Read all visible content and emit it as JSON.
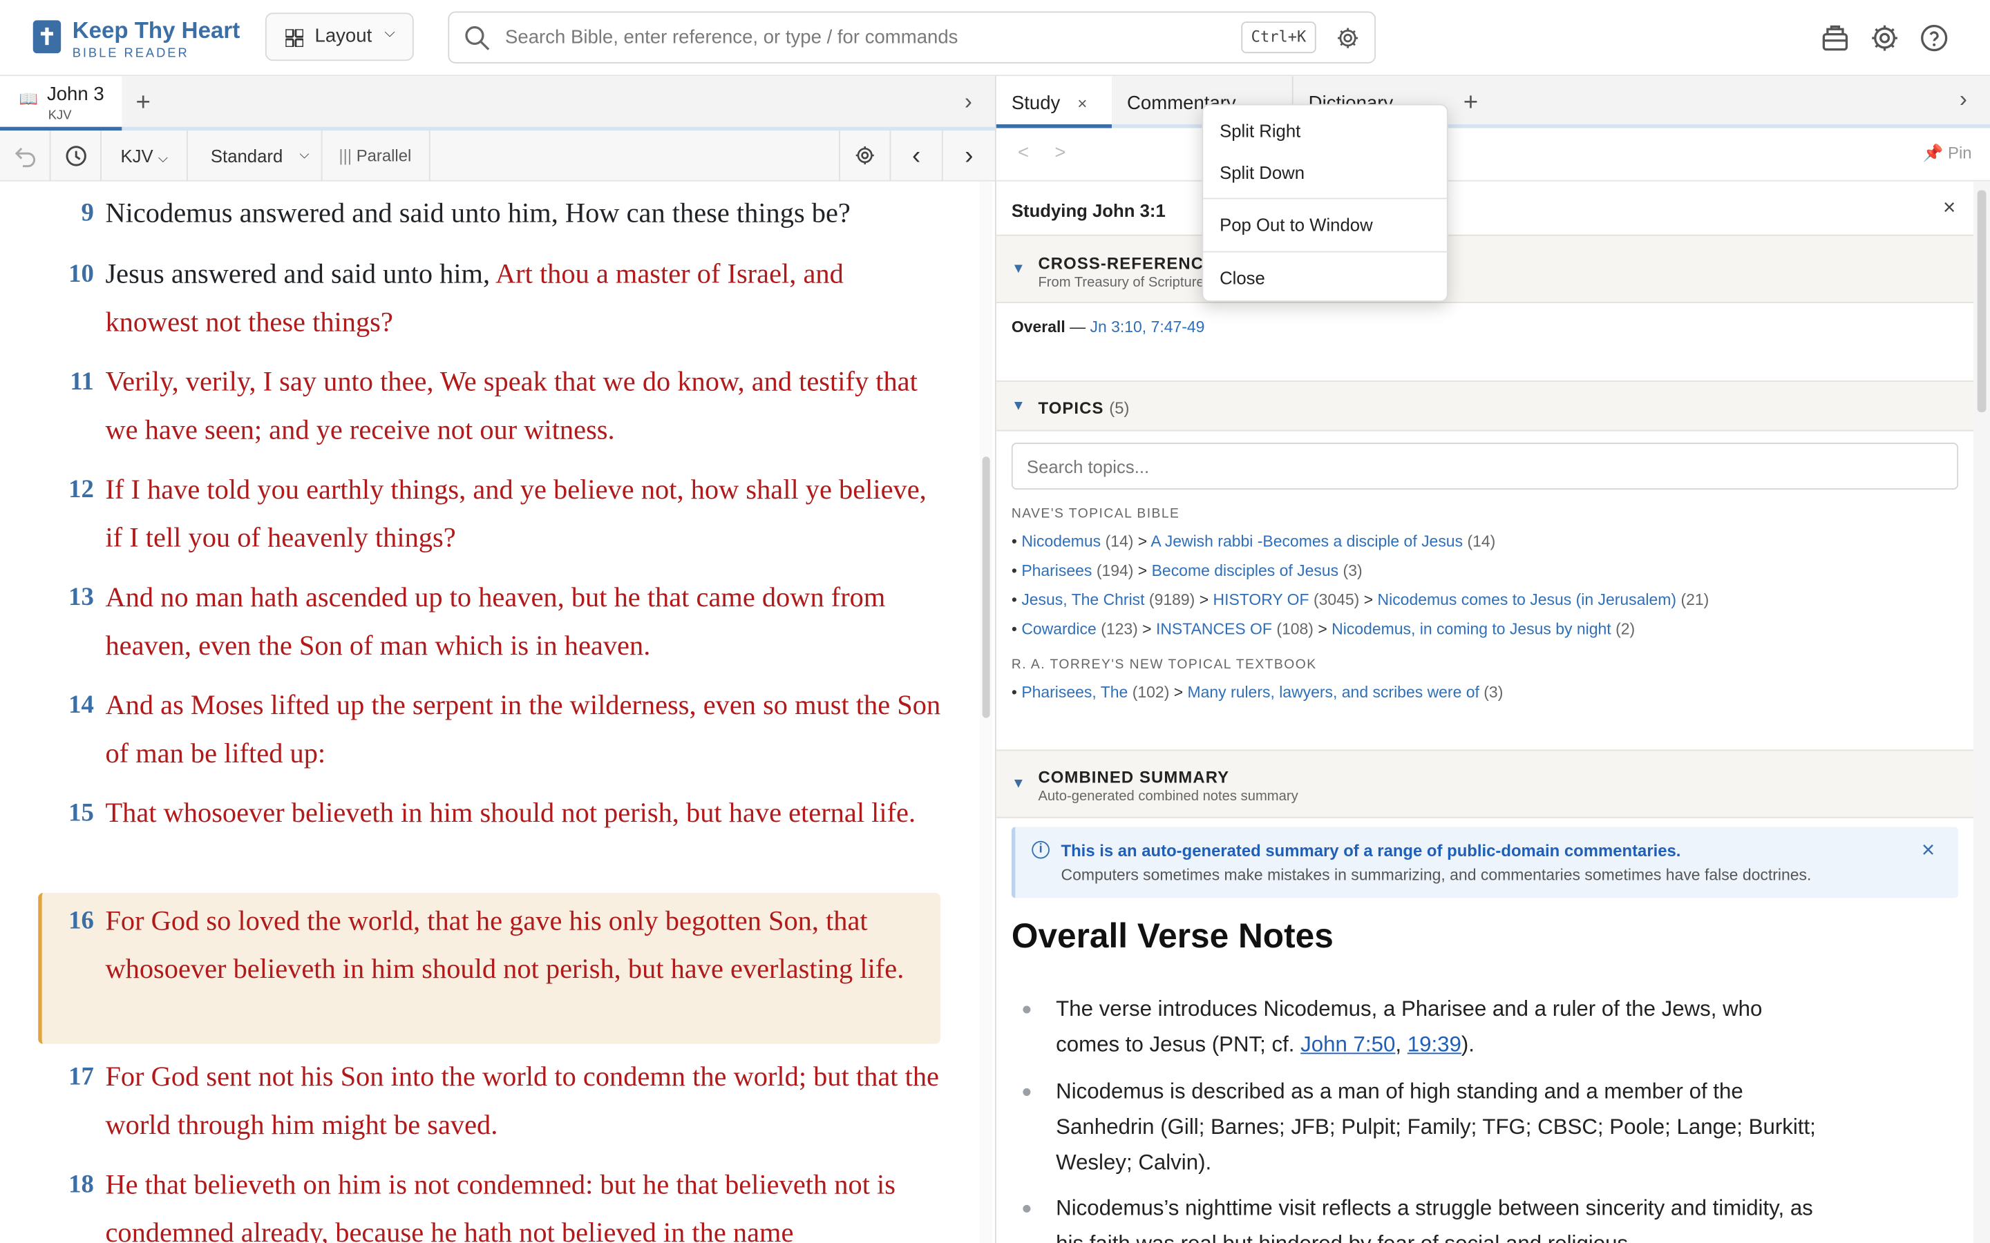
{
  "app": {
    "name": "Keep Thy Heart",
    "subtitle": "BIBLE READER"
  },
  "header": {
    "layout_label": "Layout",
    "search_placeholder": "Search Bible, enter reference, or type / for commands",
    "search_shortcut": "Ctrl+K"
  },
  "left": {
    "tab": {
      "title": "John 3",
      "version": "KJV"
    },
    "toolbar": {
      "version": "KJV",
      "mode": "Standard",
      "parallel": "Parallel"
    },
    "verses": [
      {
        "num": "9",
        "black": "Nicodemus answered and said unto him, How can these things be?",
        "red": ""
      },
      {
        "num": "10",
        "black": "Jesus answered and said unto him,",
        "red": "Art thou a master of Israel, and knowest not these things?"
      },
      {
        "num": "11",
        "black": "",
        "red": "Verily, verily, I say unto thee, We speak that we do know, and testify that we have seen; and ye receive not our witness."
      },
      {
        "num": "12",
        "black": "",
        "red": "If I have told you earthly things, and ye believe not, how shall ye believe, if I tell you of heavenly things?"
      },
      {
        "num": "13",
        "black": "",
        "red": "And no man hath ascended up to heaven, but he that came down from heaven, even the Son of man which is in heaven."
      },
      {
        "num": "14",
        "black": "",
        "red": "And as Moses lifted up the serpent in the wilderness, even so must the Son of man be lifted up:"
      },
      {
        "num": "15",
        "black": "",
        "red": "That whosoever believeth in him should not perish, but have eternal life."
      },
      {
        "num": "16",
        "black": "",
        "red": "For God so loved the world, that he gave his only begotten Son, that whosoever believeth in him should not perish, but have everlasting life."
      },
      {
        "num": "17",
        "black": "",
        "red": "For God sent not his Son into the world to condemn the world; but that the world through him might be saved."
      },
      {
        "num": "18",
        "black": "",
        "red": "He that believeth on him is not condemned: but he that believeth not is condemned already, because he hath not believed in the name"
      }
    ]
  },
  "right": {
    "tabs": [
      "Study",
      "Commentary",
      "Dictionary"
    ],
    "pin_label": "Pin",
    "studying": "Studying John 3:1",
    "context_menu": [
      "Split Right",
      "Split Down",
      "Pop Out to Window",
      "Close"
    ],
    "crossrefs": {
      "title": "CROSS-REFERENCES",
      "subtitle": "From Treasury of Scripture",
      "overall_label": "Overall",
      "dash": "—",
      "overall_refs": "Jn 3:10, 7:47-49"
    },
    "topics": {
      "title": "TOPICS",
      "count": "(5)",
      "search_placeholder": "Search topics...",
      "naves_heading": "NAVE'S TOPICAL BIBLE",
      "naves": [
        {
          "a": "Nicodemus",
          "ac": "(14)",
          "b": "A Jewish rabbi -Becomes a disciple of Jesus",
          "bc": "(14)"
        },
        {
          "a": "Pharisees",
          "ac": "(194)",
          "b": "Become disciples of Jesus",
          "bc": "(3)"
        },
        {
          "a": "Jesus, The Christ",
          "ac": "(9189)",
          "b": "HISTORY OF",
          "bc": "(3045)",
          "c": "Nicodemus comes to Jesus (in Jerusalem)",
          "cc": "(21)"
        },
        {
          "a": "Cowardice",
          "ac": "(123)",
          "b": "INSTANCES OF",
          "bc": "(108)",
          "c": "Nicodemus, in coming to Jesus by night",
          "cc": "(2)"
        }
      ],
      "torrey_heading": "R. A. TORREY'S NEW TOPICAL TEXTBOOK",
      "torrey": [
        {
          "a": "Pharisees, The",
          "ac": "(102)",
          "b": "Many rulers, lawyers, and scribes were of",
          "bc": "(3)"
        }
      ]
    },
    "summary": {
      "title": "COMBINED SUMMARY",
      "subtitle": "Auto-generated combined notes summary",
      "notice_title": "This is an auto-generated summary of a range of public-domain commentaries.",
      "notice_body": "Computers sometimes make mistakes in summarizing, and commentaries sometimes have false doctrines.",
      "heading": "Overall Verse Notes",
      "n1_pre": "The verse introduces Nicodemus, a Pharisee and a ruler of the Jews, who comes to Jesus (PNT; cf.",
      "n1_link1": "John 7:50",
      "n1_sep": ",",
      "n1_link2": "19:39",
      "n1_post": ").",
      "n2": "Nicodemus is described as a man of high standing and a member of the Sanhedrin (Gill; Barnes; JFB; Pulpit; Family; TFG; CBSC; Poole; Lange; Burkitt; Wesley; Calvin).",
      "n3": "Nicodemus’s nighttime visit reflects a struggle between sincerity and timidity, as his faith was real but hindered by fear of social and religious"
    }
  },
  "colors": {
    "accent": "#3a6ea5",
    "words_of_christ": "#b11a1a",
    "highlight": "#f9efe1",
    "highlight_border": "#e0a341",
    "link": "#2f6fb7"
  }
}
